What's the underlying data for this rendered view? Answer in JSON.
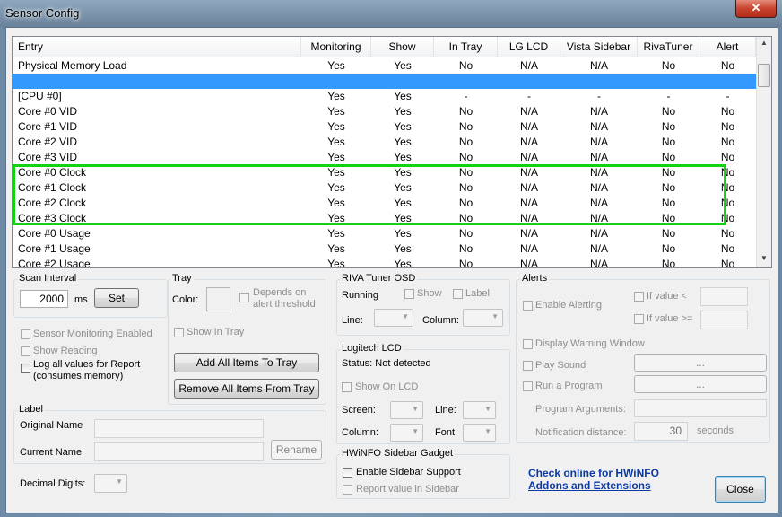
{
  "window": {
    "title": "Sensor Config",
    "close_glyph": "✕"
  },
  "list": {
    "columns": [
      "Entry",
      "Monitoring",
      "Show",
      "In Tray",
      "LG LCD",
      "Vista Sidebar",
      "RivaTuner",
      "Alert"
    ],
    "rows": [
      [
        "Physical Memory Load",
        "Yes",
        "Yes",
        "No",
        "N/A",
        "N/A",
        "No",
        "No"
      ],
      [
        "",
        "",
        "",
        "",
        "",
        "",
        "",
        ""
      ],
      [
        "[CPU #0]",
        "Yes",
        "Yes",
        "-",
        "-",
        "-",
        "-",
        "-"
      ],
      [
        "Core #0 VID",
        "Yes",
        "Yes",
        "No",
        "N/A",
        "N/A",
        "No",
        "No"
      ],
      [
        "Core #1 VID",
        "Yes",
        "Yes",
        "No",
        "N/A",
        "N/A",
        "No",
        "No"
      ],
      [
        "Core #2 VID",
        "Yes",
        "Yes",
        "No",
        "N/A",
        "N/A",
        "No",
        "No"
      ],
      [
        "Core #3 VID",
        "Yes",
        "Yes",
        "No",
        "N/A",
        "N/A",
        "No",
        "No"
      ],
      [
        "Core #0 Clock",
        "Yes",
        "Yes",
        "No",
        "N/A",
        "N/A",
        "No",
        "No"
      ],
      [
        "Core #1 Clock",
        "Yes",
        "Yes",
        "No",
        "N/A",
        "N/A",
        "No",
        "No"
      ],
      [
        "Core #2 Clock",
        "Yes",
        "Yes",
        "No",
        "N/A",
        "N/A",
        "No",
        "No"
      ],
      [
        "Core #3 Clock",
        "Yes",
        "Yes",
        "No",
        "N/A",
        "N/A",
        "No",
        "No"
      ],
      [
        "Core #0 Usage",
        "Yes",
        "Yes",
        "No",
        "N/A",
        "N/A",
        "No",
        "No"
      ],
      [
        "Core #1 Usage",
        "Yes",
        "Yes",
        "No",
        "N/A",
        "N/A",
        "No",
        "No"
      ],
      [
        "Core #2 Usage",
        "Yes",
        "Yes",
        "No",
        "N/A",
        "N/A",
        "No",
        "No"
      ]
    ],
    "selected_row": 1
  },
  "scan": {
    "title": "Scan Interval",
    "value": "2000",
    "unit": "ms",
    "set_label": "Set"
  },
  "sensor_opts": {
    "monitoring_enabled": "Sensor Monitoring Enabled",
    "show_reading": "Show Reading",
    "log_all_1": "Log all values for Report",
    "log_all_2": "(consumes memory)"
  },
  "tray": {
    "title": "Tray",
    "color_label": "Color:",
    "depends_1": "Depends on",
    "depends_2": "alert threshold",
    "show_in_tray": "Show In Tray",
    "add_all": "Add All Items To Tray",
    "remove_all": "Remove All Items From Tray"
  },
  "label_grp": {
    "title": "Label",
    "original": "Original Name",
    "current": "Current Name",
    "rename": "Rename"
  },
  "decimal": {
    "label": "Decimal Digits:"
  },
  "riva": {
    "title": "RIVA Tuner OSD",
    "running": "Running",
    "show": "Show",
    "label": "Label",
    "line": "Line:",
    "column": "Column:"
  },
  "lcd": {
    "title": "Logitech LCD",
    "status": "Status: Not detected",
    "show_on_lcd": "Show On LCD",
    "screen": "Screen:",
    "line": "Line:",
    "column": "Column:",
    "font": "Font:"
  },
  "gadget": {
    "title": "HWiNFO Sidebar Gadget",
    "enable": "Enable Sidebar Support",
    "report": "Report value in Sidebar"
  },
  "alerts": {
    "title": "Alerts",
    "enable": "Enable Alerting",
    "if_lt": "If value  <",
    "if_ge": "If value >=",
    "warn_window": "Display Warning Window",
    "play_sound": "Play Sound",
    "run_program": "Run a Program",
    "browse": "...",
    "args": "Program Arguments:",
    "notif": "Notification distance:",
    "notif_value": "30",
    "seconds": "seconds"
  },
  "link": {
    "line1": "Check online for HWiNFO",
    "line2": "Addons and Extensions"
  },
  "close_label": "Close",
  "colors": {
    "selection": "#3399ff",
    "highlight_box": "#12d312",
    "link": "#0b3aa5"
  }
}
